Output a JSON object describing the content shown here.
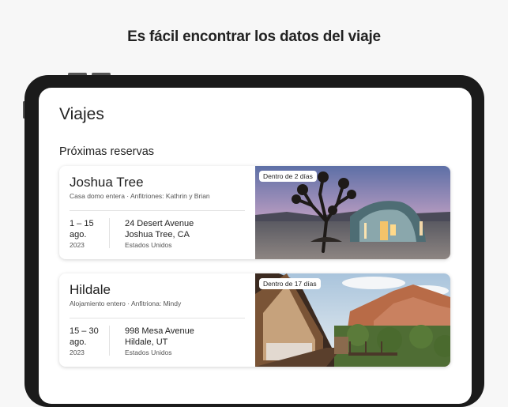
{
  "headline": "Es fácil encontrar los datos del viaje",
  "page_title": "Viajes",
  "section_title": "Próximas reservas",
  "trips": [
    {
      "name": "Joshua Tree",
      "subtitle": "Casa domo entera · Anfitriones: Kathrin y Brian",
      "dates": "1 – 15",
      "month": "ago.",
      "year": "2023",
      "street": "24 Desert Avenue",
      "city": "Joshua Tree, CA",
      "country": "Estados Unidos",
      "badge": "Dentro de 2 días",
      "photo_icon": "dome-house-photo"
    },
    {
      "name": "Hildale",
      "subtitle": "Alojamiento entero · Anfitriona: Mindy",
      "dates": "15 – 30",
      "month": "ago.",
      "year": "2023",
      "street": "998 Mesa Avenue",
      "city": "Hildale, UT",
      "country": "Estados Unidos",
      "badge": "Dentro de 17 días",
      "photo_icon": "a-frame-cabin-photo"
    }
  ],
  "colors": {
    "text": "#222222",
    "muted": "#555555",
    "background": "#f7f7f7",
    "device": "#1b1b1b"
  }
}
